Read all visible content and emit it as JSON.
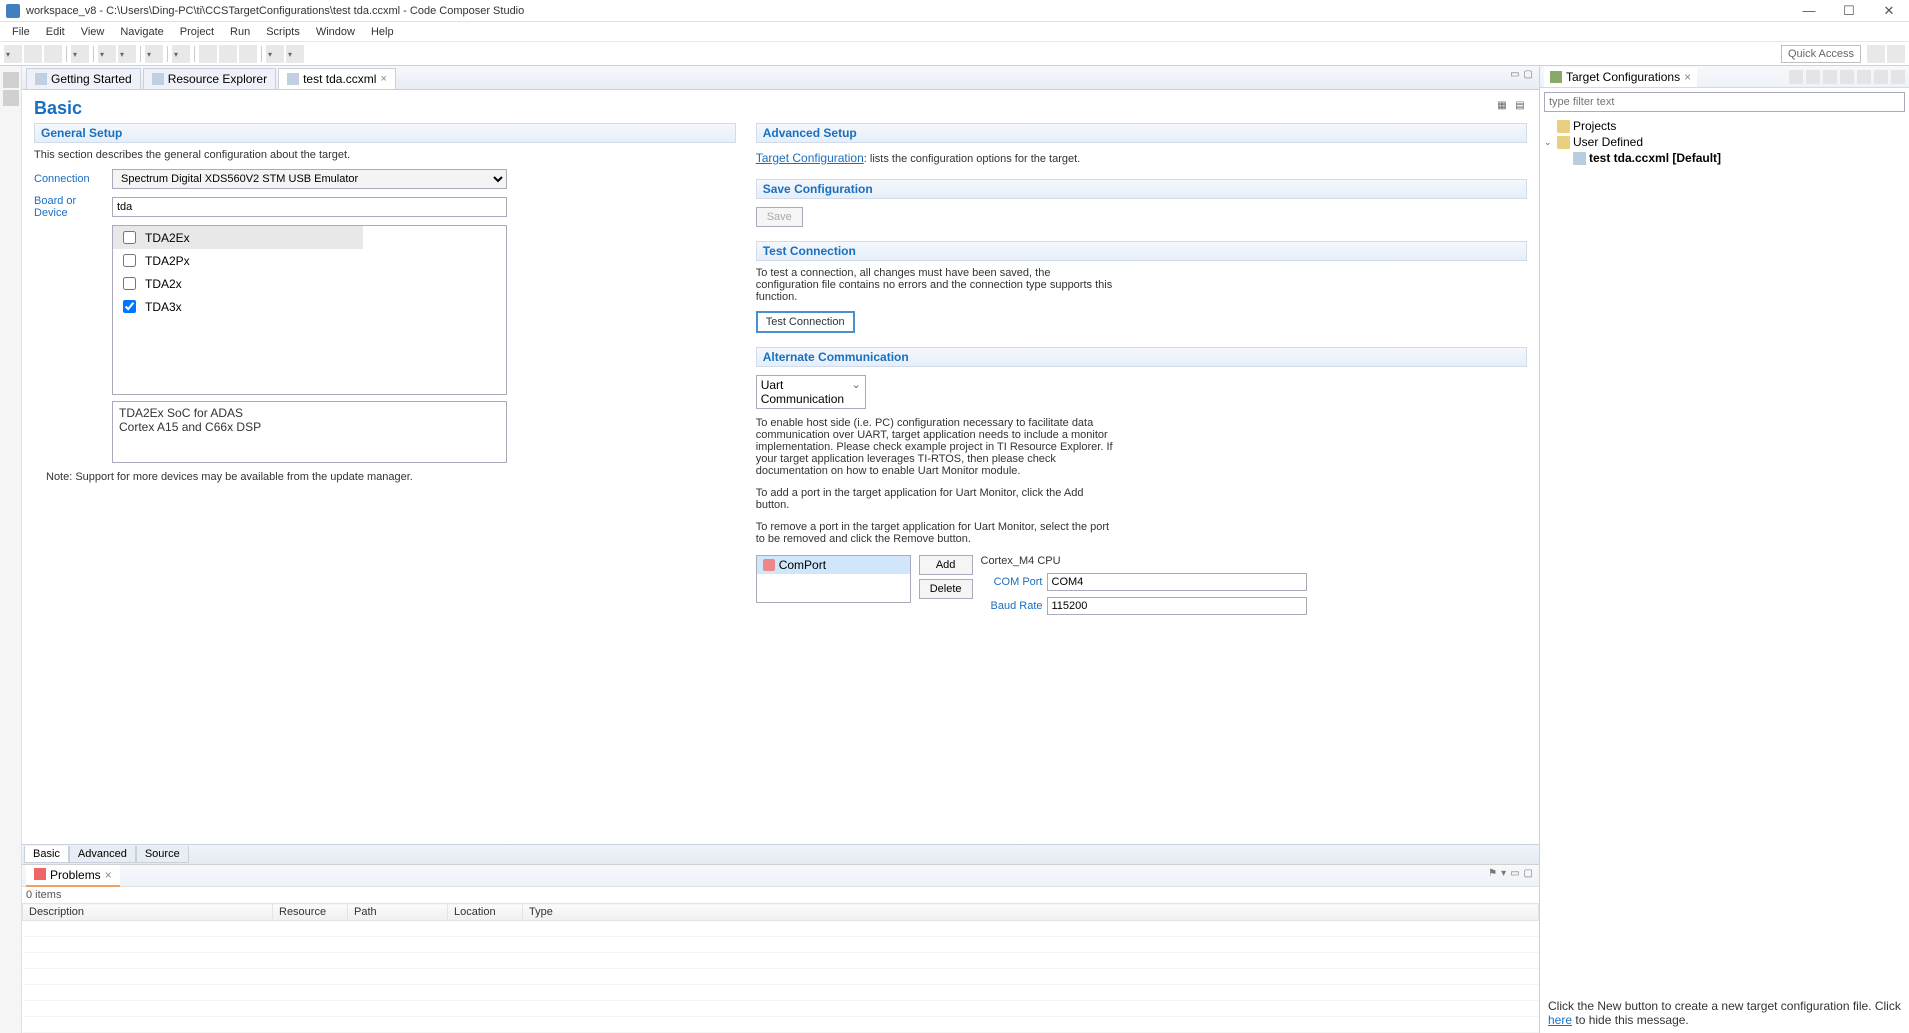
{
  "window": {
    "title": "workspace_v8 - C:\\Users\\Ding-PC\\ti\\CCSTargetConfigurations\\test tda.ccxml - Code Composer Studio"
  },
  "menu": [
    "File",
    "Edit",
    "View",
    "Navigate",
    "Project",
    "Run",
    "Scripts",
    "Window",
    "Help"
  ],
  "quick_access": "Quick Access",
  "editor_tabs": [
    {
      "label": "Getting Started",
      "active": false
    },
    {
      "label": "Resource Explorer",
      "active": false
    },
    {
      "label": "test tda.ccxml",
      "active": true
    }
  ],
  "basic": {
    "title": "Basic",
    "general_setup": "General Setup",
    "general_desc": "This section describes the general configuration about the target.",
    "connection_label": "Connection",
    "connection_value": "Spectrum Digital XDS560V2 STM USB Emulator",
    "board_label": "Board or Device",
    "board_filter": "tda",
    "devices": [
      {
        "name": "TDA2Ex",
        "checked": false,
        "sel": true
      },
      {
        "name": "TDA2Px",
        "checked": false,
        "sel": false
      },
      {
        "name": "TDA2x",
        "checked": false,
        "sel": false
      },
      {
        "name": "TDA3x",
        "checked": true,
        "sel": false
      }
    ],
    "devdesc_l1": "TDA2Ex SoC for ADAS",
    "devdesc_l2": "Cortex A15 and C66x DSP",
    "note": "Note: Support for more devices may be available from the update manager."
  },
  "advanced": {
    "title": "Advanced Setup",
    "target_cfg_link": "Target Configuration",
    "target_cfg_rest": ": lists the configuration options for the target.",
    "save_hdr": "Save Configuration",
    "save_btn": "Save",
    "test_hdr": "Test Connection",
    "test_desc": "To test a connection, all changes must have been saved, the configuration file contains no errors and the connection type supports this function.",
    "test_btn": "Test Connection",
    "alt_hdr": "Alternate Communication",
    "alt_sel": "Uart Communication",
    "alt_desc1": "To enable host side (i.e. PC) configuration necessary to facilitate data communication over UART, target application needs to include a monitor implementation. Please check example project in TI Resource Explorer. If your target application leverages TI-RTOS, then please check documentation on how to enable Uart Monitor module.",
    "alt_desc2": "To add a port in the target application for Uart Monitor, click the Add button.",
    "alt_desc3": "To remove a port in the target application for Uart Monitor, select the port to be removed and click the Remove button.",
    "port_item": "ComPort",
    "add_btn": "Add",
    "delete_btn": "Delete",
    "cpu_label": "Cortex_M4 CPU",
    "comport_label": "COM Port",
    "comport_value": "COM4",
    "baud_label": "Baud Rate",
    "baud_value": "115200"
  },
  "bottom_tabs": [
    "Basic",
    "Advanced",
    "Source"
  ],
  "problems": {
    "title": "Problems",
    "count": "0 items",
    "cols": [
      "Description",
      "Resource",
      "Path",
      "Location",
      "Type"
    ]
  },
  "rightpanel": {
    "title": "Target Configurations",
    "filter_placeholder": "type filter text",
    "tree": {
      "projects": "Projects",
      "userdef": "User Defined",
      "file": "test tda.ccxml [Default]"
    },
    "help_pre": "Click the New button to create a new target configuration file. Click ",
    "help_link": "here",
    "help_post": " to hide this message."
  }
}
